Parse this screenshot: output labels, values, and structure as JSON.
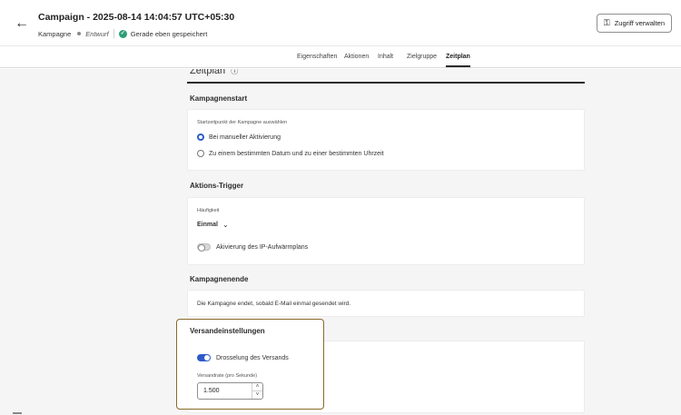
{
  "header": {
    "title": "Campaign - 2025-08-14 14:04:57 UTC+05:30",
    "type_label": "Kampagne",
    "status_label": "Entwurf",
    "save_status": "Gerade eben gespeichert",
    "access_button_label": "Zugriff verwalten"
  },
  "tabs": [
    {
      "label": "Eigenschaften",
      "active": false
    },
    {
      "label": "Aktionen",
      "active": false
    },
    {
      "label": "Inhalt",
      "active": false
    },
    {
      "label": "Zielgruppe",
      "active": false
    },
    {
      "label": "Zeitplan",
      "active": true
    }
  ],
  "schedule": {
    "title": "Zeitplan"
  },
  "campaign_start": {
    "heading": "Kampagnenstart",
    "field_label": "Startzeitpunkt der Kampagne auswählen",
    "options": [
      {
        "label": "Bei manueller Aktivierung",
        "selected": true
      },
      {
        "label": "Zu einem bestimmten Datum und zu einer bestimmten Uhrzeit",
        "selected": false
      }
    ]
  },
  "action_trigger": {
    "heading": "Aktions-Trigger",
    "frequency_label": "Häufigkeit",
    "frequency_value": "Einmal",
    "warmup_toggle_label": "Akivierung des IP-Aufwärmplans",
    "warmup_enabled": false
  },
  "campaign_end": {
    "heading": "Kampagnenende",
    "text": "Die Kampagne endet, sobald E-Mail einmal gesendet wird."
  },
  "delivery_settings": {
    "heading": "Versandeinstellungen",
    "throttle_label": "Drosselung des Versands",
    "throttle_enabled": true,
    "rate_label": "Versandrate (pro Sekunde)",
    "rate_value": "1.500"
  },
  "colors": {
    "accent": "#2e5bc9",
    "highlight_border": "#8a6a2a",
    "success": "#2d9d78"
  }
}
